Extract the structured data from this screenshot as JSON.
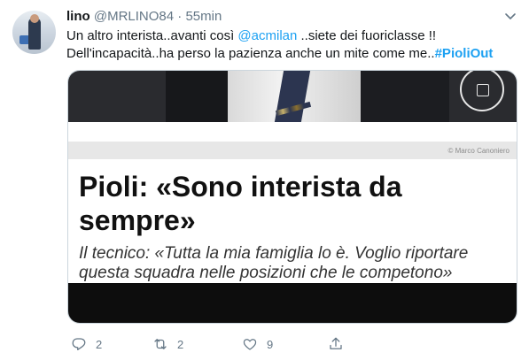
{
  "tweet": {
    "author_name": "lino",
    "handle": "@MRLINO84",
    "separator": "·",
    "time": "55min",
    "text_line1_prefix": "Un altro interista..avanti così ",
    "mention": "@acmilan",
    "text_line1_suffix": " ..siete dei fuoriclasse !!",
    "text_line2_prefix": "Dell'incapacità..ha perso la pazienza anche un mite come me..",
    "hashtag": "#PioliOut"
  },
  "card": {
    "photo_credit": "© Marco Canoniero",
    "headline": "Pioli: «Sono interista da sempre»",
    "subheadline": "Il tecnico: «Tutta la mia famiglia lo è. Voglio riportare questa squadra nelle posizioni che le competono»"
  },
  "actions": {
    "reply_count": "2",
    "retweet_count": "2",
    "like_count": "9"
  },
  "icons": {
    "reply": "reply-icon",
    "retweet": "retweet-icon",
    "like": "heart-icon",
    "share": "share-icon",
    "more": "chevron-down-icon",
    "camera": "camera-icon"
  },
  "colors": {
    "link": "#1da1f2",
    "muted": "#657786",
    "text": "#14171a",
    "border": "#ccd6dd"
  }
}
